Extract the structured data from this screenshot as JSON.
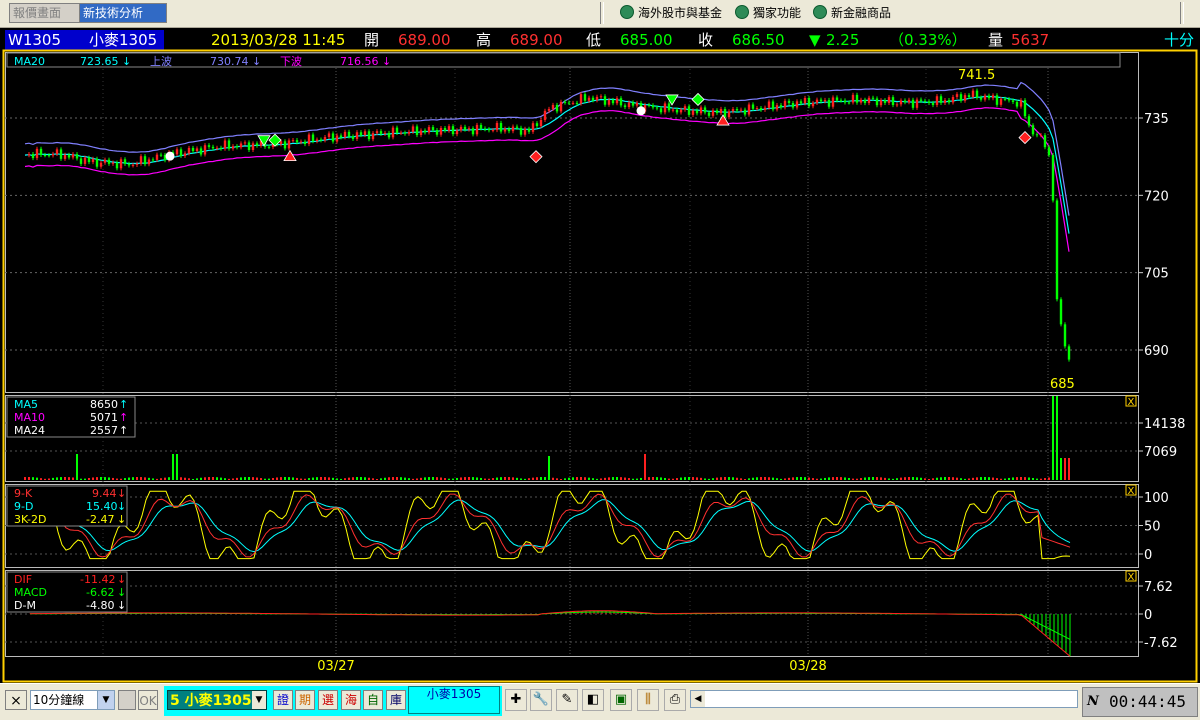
{
  "topbar": {
    "tab_quote": "報價畫面",
    "tab_tech": "新技術分析",
    "link_overseas": "海外股市與基金",
    "link_exclusive": "獨家功能",
    "link_finance": "新金融商品"
  },
  "quote": {
    "code": "W1305",
    "name": "小麥1305",
    "datetime": "2013/03/28 11:45",
    "open_label": "開",
    "open": "689.00",
    "high_label": "高",
    "high": "689.00",
    "low_label": "低",
    "low": "685.00",
    "close_label": "收",
    "close": "686.50",
    "change_arrow": "▼",
    "change": "2.25",
    "change_pct": "（0.33%）",
    "vol_label": "量",
    "vol": "5637",
    "interval_right": "十分"
  },
  "price_panel": {
    "ma_label": "MA20",
    "ma_value": "723.65",
    "up_label": "上波",
    "up_value": "730.74",
    "dn_label": "下波",
    "dn_value": "716.56",
    "arrow_down": "↓",
    "peak_label": "741.5",
    "low_label": "685",
    "y_ticks": [
      "735",
      "720",
      "705",
      "690"
    ],
    "colors": {
      "ma": "#00FFFF",
      "up": "#FF00FF",
      "dn": "#FF00FF"
    }
  },
  "volume_panel": {
    "ma5_label": "MA5",
    "ma5_value": "8650",
    "ma10_label": "MA10",
    "ma10_value": "5071",
    "ma24_label": "MA24",
    "ma24_value": "2557",
    "arrow_up": "↑",
    "y_ticks": [
      "14138",
      "7069"
    ]
  },
  "kd_panel": {
    "k_label": "9-K",
    "k_value": "9.44",
    "d_label": "9-D",
    "d_value": "15.40",
    "j_label": "3K-2D",
    "j_value": "-2.47",
    "arrow_down": "↓",
    "y_ticks": [
      "100",
      "50",
      "0"
    ]
  },
  "macd_panel": {
    "dif_label": "DIF",
    "dif_value": "-11.42",
    "macd_label": "MACD",
    "macd_value": "-6.62",
    "dm_label": "D-M",
    "dm_value": "-4.80",
    "arrow_down": "↓",
    "y_ticks": [
      "7.62",
      "0",
      "-7.62"
    ]
  },
  "x_axis": {
    "labels": [
      "03/27",
      "03/28"
    ]
  },
  "close_glyph": "X",
  "bottombar": {
    "interval": "10分鐘線",
    "ok": "OK",
    "symbol": "5 小麥1305",
    "btn_zheng": "證",
    "btn_qi": "期",
    "btn_xuan": "選",
    "btn_hai": "海",
    "btn_zi": "自",
    "btn_ku": "庫",
    "cname": "小麥1305",
    "clock_n": "N",
    "clock": "00:44:45"
  }
}
